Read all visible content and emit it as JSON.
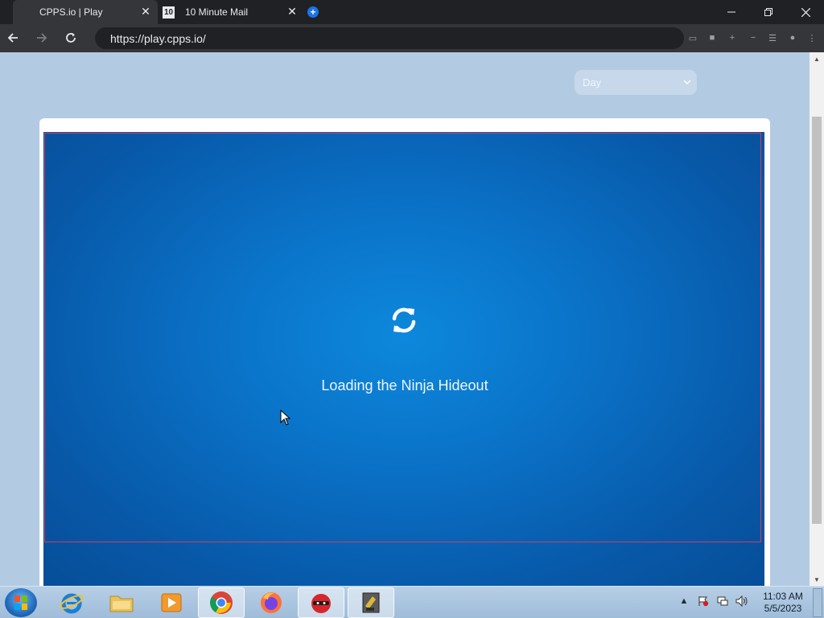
{
  "browser": {
    "tabs": [
      {
        "title": "CPPS.io | Play",
        "active": true
      },
      {
        "title": "10 Minute Mail",
        "active": false,
        "favicon_text": "10"
      }
    ],
    "address": "https://play.cpps.io/"
  },
  "page": {
    "time_select": {
      "value": "Day"
    },
    "loading_text": "Loading the Ninja Hideout"
  },
  "taskbar": {
    "items": [
      "internet-explorer",
      "file-explorer",
      "media-player",
      "chrome",
      "firefox",
      "cpps-app",
      "game-app"
    ],
    "clock_time": "11:03 AM",
    "clock_date": "5/5/2023"
  },
  "colors": {
    "game_bg": "#0a73c8",
    "game_border": "#d03c5e",
    "page_bg": "#b3cbe2"
  }
}
